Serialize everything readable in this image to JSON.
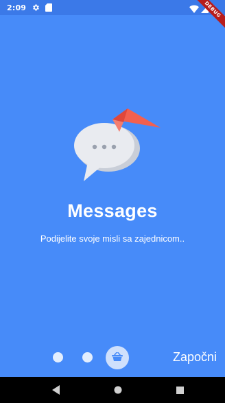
{
  "status_bar": {
    "time": "2:09",
    "icons": [
      "gear-icon",
      "sd-card-icon",
      "wifi-icon",
      "signal-icon",
      "battery-icon"
    ]
  },
  "debug_banner": {
    "label": "DEBUG"
  },
  "onboarding": {
    "illustration": "chat-bubble-icon",
    "title": "Messages",
    "subtitle": "Podijelite svoje misli sa zajednicom..",
    "pages_total": 3,
    "current_page": 3,
    "active_page_icon": "basket-icon",
    "start_label": "Započni"
  },
  "nav_bar": {
    "buttons": [
      "back-icon",
      "home-icon",
      "recents-icon"
    ]
  },
  "colors": {
    "background": "#478bf9",
    "status_bar": "#3b79e8",
    "bubble": "#e8eaf0",
    "accent": "#f2604f",
    "dot_active": "#cfe0fc"
  }
}
